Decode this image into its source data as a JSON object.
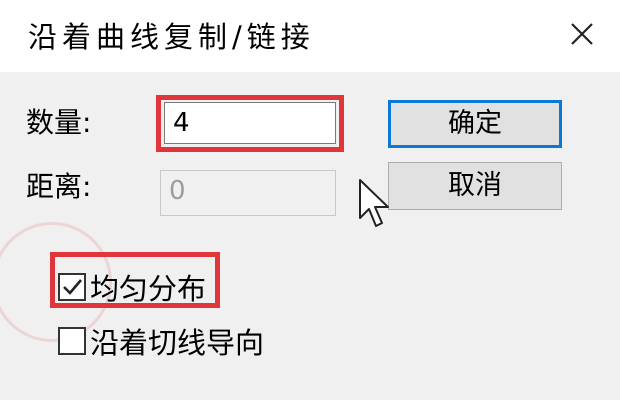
{
  "title": "沿着曲线复制/链接",
  "quantity": {
    "label": "数量:",
    "value": "4"
  },
  "distance": {
    "label": "距离:",
    "value": "0"
  },
  "buttons": {
    "ok": "确定",
    "cancel": "取消"
  },
  "checkboxes": [
    {
      "label": "均匀分布",
      "checked": true
    },
    {
      "label": "沿着切线导向",
      "checked": false
    }
  ],
  "colors": {
    "highlight": "#e0353a",
    "default_button_border": "#0a78d7"
  }
}
